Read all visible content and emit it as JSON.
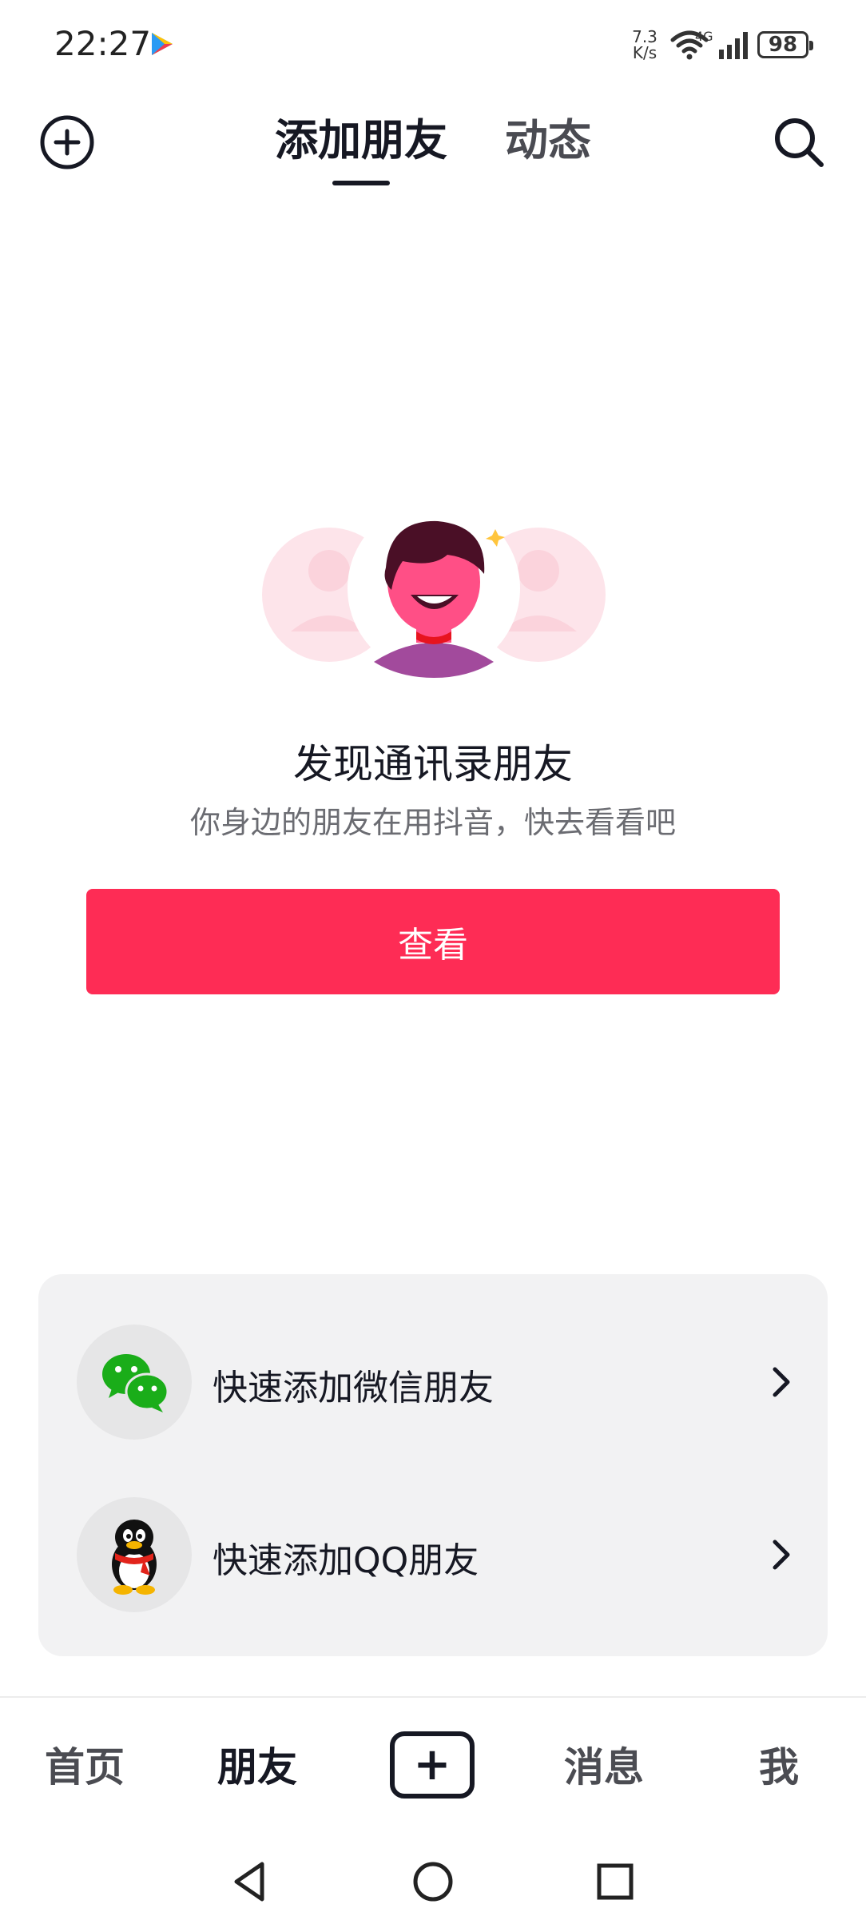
{
  "status_bar": {
    "time": "22:27",
    "net_speed_value": "7.3",
    "net_speed_unit": "K/s",
    "signal_label": "4G",
    "battery": "98"
  },
  "header": {
    "tabs": [
      {
        "label": "添加朋友",
        "active": true
      },
      {
        "label": "动态",
        "active": false
      }
    ]
  },
  "discover": {
    "title": "发现通讯录朋友",
    "subtitle": "你身边的朋友在用抖音，快去看看吧",
    "button_label": "查看"
  },
  "quick_add": [
    {
      "label": "快速添加微信朋友",
      "icon": "wechat-icon"
    },
    {
      "label": "快速添加QQ朋友",
      "icon": "qq-icon"
    }
  ],
  "bottom_nav": {
    "home": "首页",
    "friends": "朋友",
    "create": "+",
    "messages": "消息",
    "me": "我"
  },
  "colors": {
    "accent": "#fe2c55",
    "card_bg": "#f2f2f3",
    "text_primary": "#161823",
    "text_secondary": "#6b6c72"
  }
}
